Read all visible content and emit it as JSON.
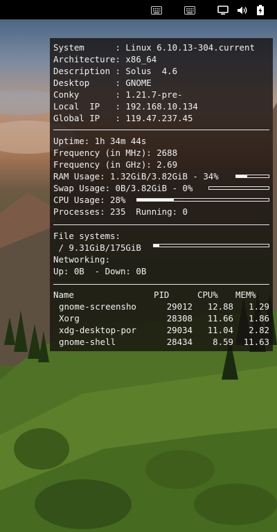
{
  "panel": {
    "icons": [
      "keyboard-icon",
      "keyboard-icon",
      "display-icon",
      "volume-icon",
      "battery-icon"
    ]
  },
  "conky": {
    "system": {
      "lines": [
        "System      : Linux 6.10.13-304.current",
        "Architecture: x86_64",
        "Description : Solus  4.6",
        "Desktop     : GNOME",
        "Conky       : 1.21.7-pre-",
        "Local  IP   : 192.168.10.134",
        "Global IP   : 119.47.237.45"
      ]
    },
    "status": {
      "uptime": "Uptime: 1h 34m 44s",
      "freq_mhz": "Frequency (in MHz): 2688",
      "freq_ghz": "Frequency (in GHz): 2.69",
      "ram": "RAM Usage: 1.32GiB/3.82GiB - 34%",
      "ram_percent": 34,
      "swap": "Swap Usage: 0B/3.82GiB - 0%",
      "swap_percent": 0,
      "cpu": "CPU Usage: 28%",
      "cpu_percent": 28,
      "processes": "Processes: 235  Running: 0"
    },
    "fs": {
      "heading": "File systems:",
      "root": " / 9.31GiB/175GiB",
      "root_percent": 5,
      "net_heading": "Networking:",
      "net": "Up: 0B  - Down: 0B"
    },
    "procs": {
      "headers": [
        "Name",
        "PID",
        "CPU%",
        "MEM%"
      ],
      "rows": [
        {
          "name": "gnome-screensho",
          "pid": "29012",
          "cpu": "12.88",
          "mem": "1.29"
        },
        {
          "name": "Xorg",
          "pid": "28308",
          "cpu": "11.66",
          "mem": "1.86"
        },
        {
          "name": "xdg-desktop-por",
          "pid": "29034",
          "cpu": "11.04",
          "mem": "2.82"
        },
        {
          "name": "gnome-shell",
          "pid": "28434",
          "cpu": "8.59",
          "mem": "11.63"
        }
      ]
    }
  }
}
